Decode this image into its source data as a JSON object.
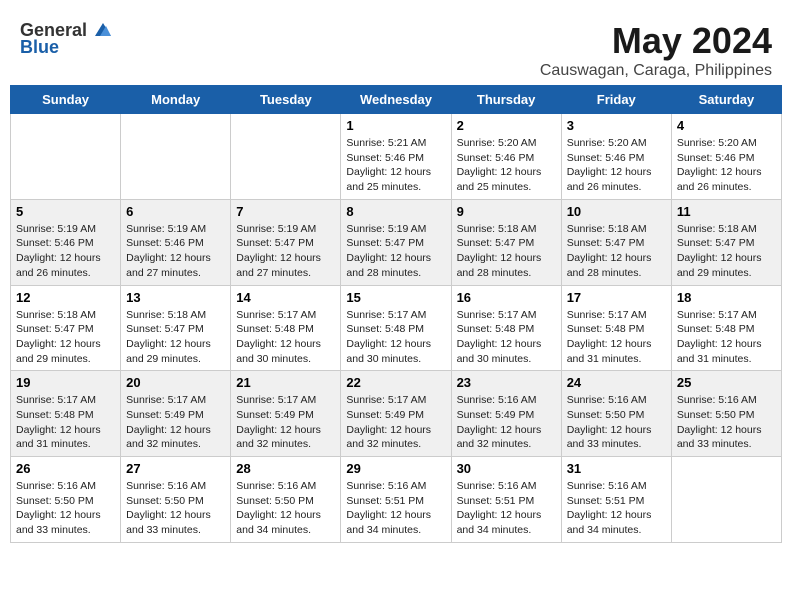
{
  "header": {
    "logo_general": "General",
    "logo_blue": "Blue",
    "month": "May 2024",
    "location": "Causwagan, Caraga, Philippines"
  },
  "days": [
    "Sunday",
    "Monday",
    "Tuesday",
    "Wednesday",
    "Thursday",
    "Friday",
    "Saturday"
  ],
  "weeks": [
    [
      {
        "day": "",
        "content": ""
      },
      {
        "day": "",
        "content": ""
      },
      {
        "day": "",
        "content": ""
      },
      {
        "day": "1",
        "content": "Sunrise: 5:21 AM\nSunset: 5:46 PM\nDaylight: 12 hours\nand 25 minutes."
      },
      {
        "day": "2",
        "content": "Sunrise: 5:20 AM\nSunset: 5:46 PM\nDaylight: 12 hours\nand 25 minutes."
      },
      {
        "day": "3",
        "content": "Sunrise: 5:20 AM\nSunset: 5:46 PM\nDaylight: 12 hours\nand 26 minutes."
      },
      {
        "day": "4",
        "content": "Sunrise: 5:20 AM\nSunset: 5:46 PM\nDaylight: 12 hours\nand 26 minutes."
      }
    ],
    [
      {
        "day": "5",
        "content": "Sunrise: 5:19 AM\nSunset: 5:46 PM\nDaylight: 12 hours\nand 26 minutes."
      },
      {
        "day": "6",
        "content": "Sunrise: 5:19 AM\nSunset: 5:46 PM\nDaylight: 12 hours\nand 27 minutes."
      },
      {
        "day": "7",
        "content": "Sunrise: 5:19 AM\nSunset: 5:47 PM\nDaylight: 12 hours\nand 27 minutes."
      },
      {
        "day": "8",
        "content": "Sunrise: 5:19 AM\nSunset: 5:47 PM\nDaylight: 12 hours\nand 28 minutes."
      },
      {
        "day": "9",
        "content": "Sunrise: 5:18 AM\nSunset: 5:47 PM\nDaylight: 12 hours\nand 28 minutes."
      },
      {
        "day": "10",
        "content": "Sunrise: 5:18 AM\nSunset: 5:47 PM\nDaylight: 12 hours\nand 28 minutes."
      },
      {
        "day": "11",
        "content": "Sunrise: 5:18 AM\nSunset: 5:47 PM\nDaylight: 12 hours\nand 29 minutes."
      }
    ],
    [
      {
        "day": "12",
        "content": "Sunrise: 5:18 AM\nSunset: 5:47 PM\nDaylight: 12 hours\nand 29 minutes."
      },
      {
        "day": "13",
        "content": "Sunrise: 5:18 AM\nSunset: 5:47 PM\nDaylight: 12 hours\nand 29 minutes."
      },
      {
        "day": "14",
        "content": "Sunrise: 5:17 AM\nSunset: 5:48 PM\nDaylight: 12 hours\nand 30 minutes."
      },
      {
        "day": "15",
        "content": "Sunrise: 5:17 AM\nSunset: 5:48 PM\nDaylight: 12 hours\nand 30 minutes."
      },
      {
        "day": "16",
        "content": "Sunrise: 5:17 AM\nSunset: 5:48 PM\nDaylight: 12 hours\nand 30 minutes."
      },
      {
        "day": "17",
        "content": "Sunrise: 5:17 AM\nSunset: 5:48 PM\nDaylight: 12 hours\nand 31 minutes."
      },
      {
        "day": "18",
        "content": "Sunrise: 5:17 AM\nSunset: 5:48 PM\nDaylight: 12 hours\nand 31 minutes."
      }
    ],
    [
      {
        "day": "19",
        "content": "Sunrise: 5:17 AM\nSunset: 5:48 PM\nDaylight: 12 hours\nand 31 minutes."
      },
      {
        "day": "20",
        "content": "Sunrise: 5:17 AM\nSunset: 5:49 PM\nDaylight: 12 hours\nand 32 minutes."
      },
      {
        "day": "21",
        "content": "Sunrise: 5:17 AM\nSunset: 5:49 PM\nDaylight: 12 hours\nand 32 minutes."
      },
      {
        "day": "22",
        "content": "Sunrise: 5:17 AM\nSunset: 5:49 PM\nDaylight: 12 hours\nand 32 minutes."
      },
      {
        "day": "23",
        "content": "Sunrise: 5:16 AM\nSunset: 5:49 PM\nDaylight: 12 hours\nand 32 minutes."
      },
      {
        "day": "24",
        "content": "Sunrise: 5:16 AM\nSunset: 5:50 PM\nDaylight: 12 hours\nand 33 minutes."
      },
      {
        "day": "25",
        "content": "Sunrise: 5:16 AM\nSunset: 5:50 PM\nDaylight: 12 hours\nand 33 minutes."
      }
    ],
    [
      {
        "day": "26",
        "content": "Sunrise: 5:16 AM\nSunset: 5:50 PM\nDaylight: 12 hours\nand 33 minutes."
      },
      {
        "day": "27",
        "content": "Sunrise: 5:16 AM\nSunset: 5:50 PM\nDaylight: 12 hours\nand 33 minutes."
      },
      {
        "day": "28",
        "content": "Sunrise: 5:16 AM\nSunset: 5:50 PM\nDaylight: 12 hours\nand 34 minutes."
      },
      {
        "day": "29",
        "content": "Sunrise: 5:16 AM\nSunset: 5:51 PM\nDaylight: 12 hours\nand 34 minutes."
      },
      {
        "day": "30",
        "content": "Sunrise: 5:16 AM\nSunset: 5:51 PM\nDaylight: 12 hours\nand 34 minutes."
      },
      {
        "day": "31",
        "content": "Sunrise: 5:16 AM\nSunset: 5:51 PM\nDaylight: 12 hours\nand 34 minutes."
      },
      {
        "day": "",
        "content": ""
      }
    ]
  ]
}
